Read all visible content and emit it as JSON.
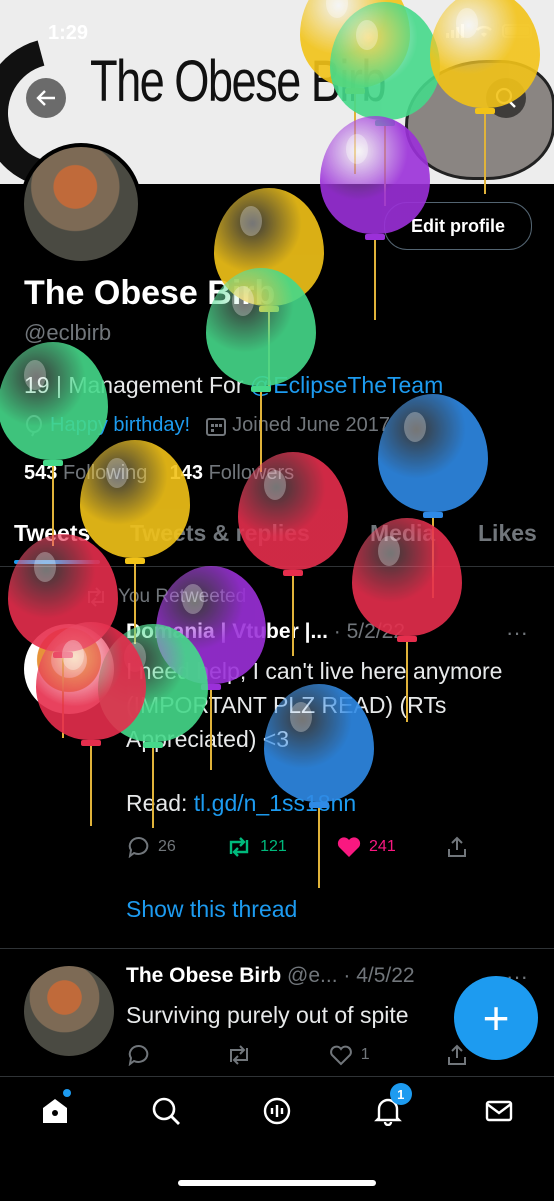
{
  "status_bar": {
    "time": "1:29"
  },
  "banner": {
    "text": "The Obese Birb"
  },
  "profile": {
    "edit_button": "Edit profile",
    "name": "The Obese Birb",
    "handle": "@eclbirb",
    "bio_prefix": "19 | Management For",
    "bio_mention": "@EclipseTheTeam",
    "birthday": "Happy birthday!",
    "joined": "Joined June 2017",
    "following_count": "543",
    "following_label": "Following",
    "followers_count": "143",
    "followers_label": "Followers"
  },
  "tabs": [
    {
      "label": "Tweets"
    },
    {
      "label": "Tweets & replies"
    },
    {
      "label": "Media"
    },
    {
      "label": "Likes"
    }
  ],
  "tweets": [
    {
      "retweet_label": "You Retweeted",
      "author": "Domania | Vtuber |...",
      "meta": "· 5/2/22",
      "more": "···",
      "text": "I need help, I can't live here anymore (IMPORTANT PLZ READ) (RTs Appreciated) <3",
      "read_prefix": "Read:",
      "read_link": "tl.gd/n_1ss18nn",
      "replies": "26",
      "retweets": "121",
      "likes": "241",
      "show_thread": "Show this thread"
    },
    {
      "author": "The Obese Birb",
      "meta": "@e... · 4/5/22",
      "more": "···",
      "text": "Surviving purely out of spite",
      "likes": "1"
    }
  ],
  "fab": {
    "label": "+"
  },
  "bottom_nav": {
    "notification_count": "1"
  },
  "colors": {
    "accent": "#1d9bf0",
    "retweet_green": "#00ba7c",
    "like_pink": "#f91880",
    "balloon_colors": [
      "#f2c318",
      "#45d98a",
      "#9b30d9",
      "#e62e4d",
      "#2f8ae6"
    ]
  }
}
